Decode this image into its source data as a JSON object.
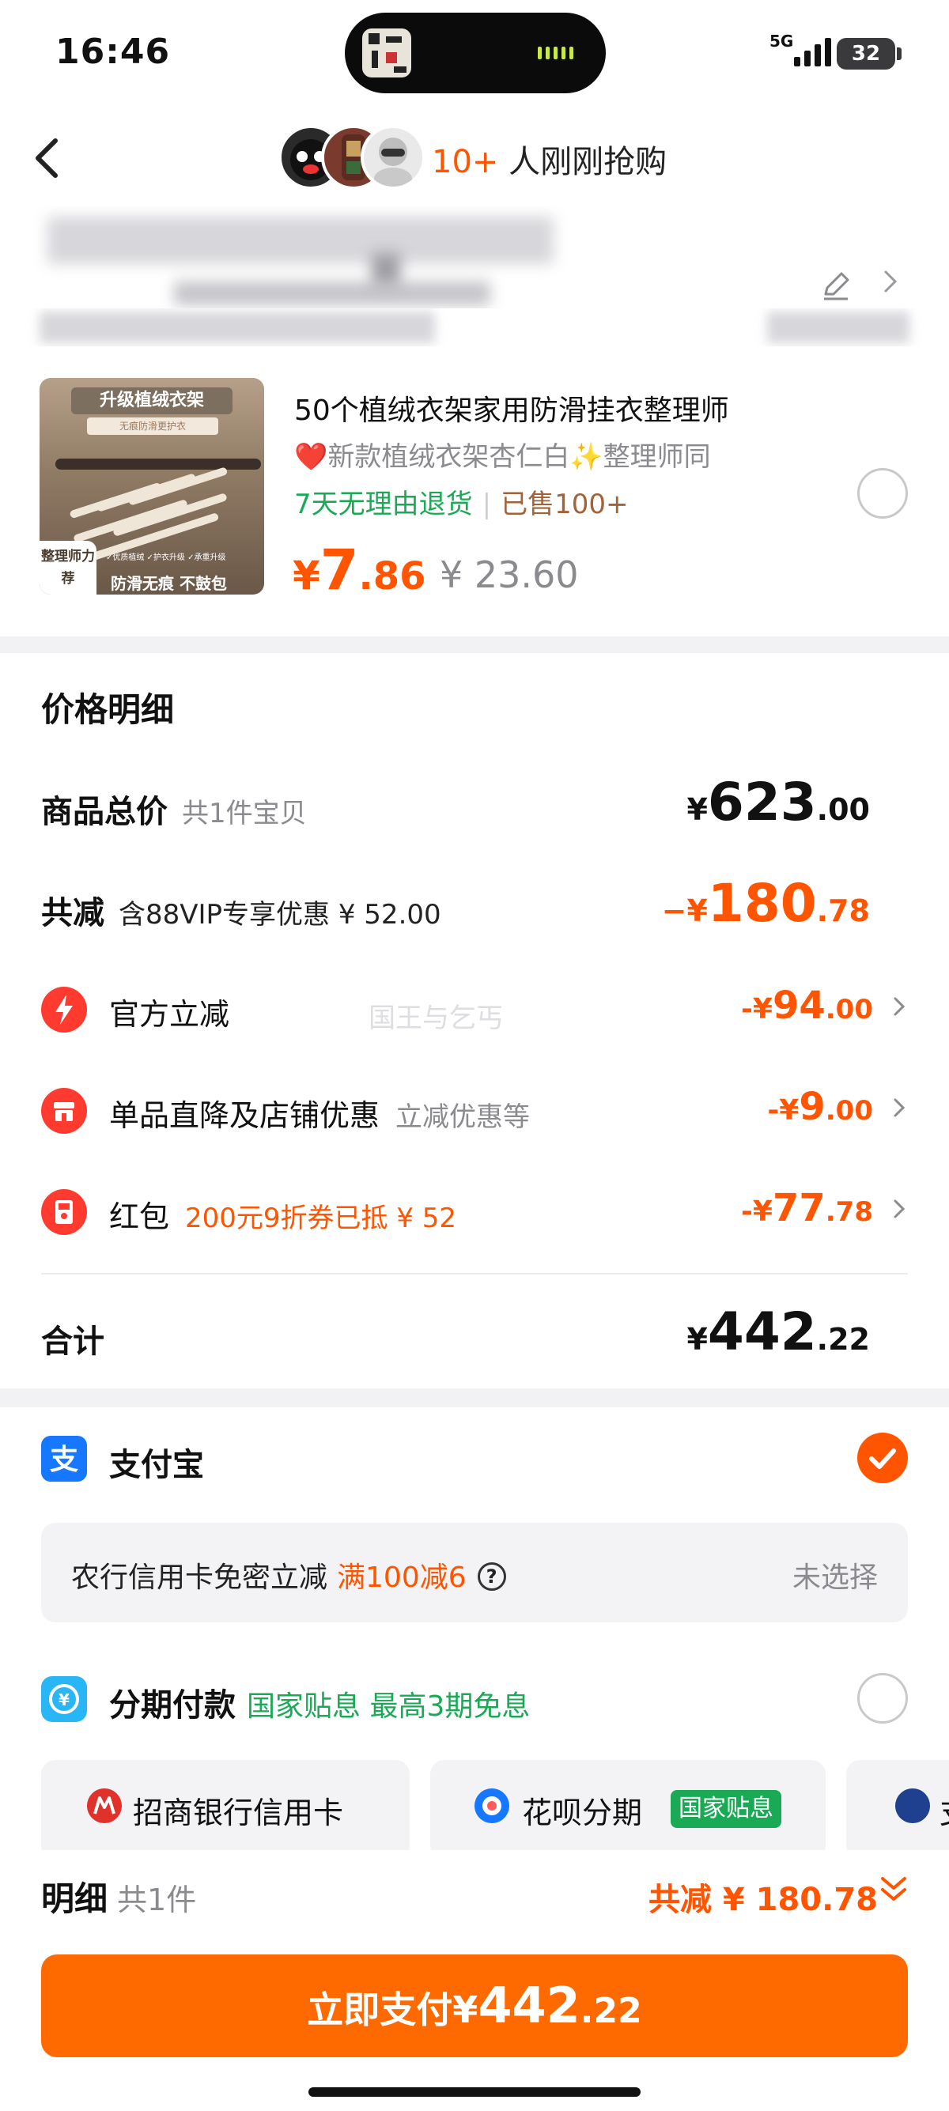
{
  "status_bar": {
    "time": "16:46",
    "network": "5G",
    "battery": "32"
  },
  "header": {
    "buyers_count": "10+",
    "buyers_text": " 人刚刚抢购"
  },
  "product": {
    "title": "50个植绒衣架家用防滑挂衣整理师",
    "sku": "❤️新款植绒衣架杏仁白✨整理师同",
    "return_policy": "7天无理由退货",
    "sold": "已售100+",
    "price_symbol": "¥",
    "price_int": "7",
    "price_dec": ".86",
    "original_price": "¥ 23.60",
    "thumb_banner": "升级植绒衣架",
    "thumb_sub": "无痕防滑更护衣",
    "thumb_badge": "整理师力荐",
    "thumb_features": "✓优质植绒 ✓护衣升级 ✓承重升级",
    "thumb_slogan": "防滑无痕 不鼓包"
  },
  "price_detail": {
    "title": "价格明细",
    "total": {
      "label": "商品总价",
      "note": "共1件宝贝",
      "symbol": "¥",
      "int": "623",
      "dec": ".00"
    },
    "reduce": {
      "label": "共减",
      "note": "含88VIP专享优惠 ¥ 52.00",
      "symbol": "−¥",
      "int": "180",
      "dec": ".78"
    },
    "items": [
      {
        "label": "官方立减",
        "note": "",
        "symbol": "-¥",
        "int": "94",
        "dec": ".00"
      },
      {
        "label": "单品直降及店铺优惠",
        "note": "立减优惠等",
        "symbol": "-¥",
        "int": "9",
        "dec": ".00"
      },
      {
        "label": "红包",
        "note": "200元9折券已抵 ¥ 52",
        "symbol": "-¥",
        "int": "77",
        "dec": ".78"
      }
    ],
    "sum": {
      "label": "合计",
      "symbol": "¥",
      "int": "442",
      "dec": ".22"
    },
    "watermark": "国王与乞丐"
  },
  "payment": {
    "alipay": "支付宝",
    "card_offer": "农行信用卡免密立减",
    "card_promo": "满100减6",
    "card_help": "?",
    "card_status": "未选择",
    "installment": "分期付款",
    "installment_note": "国家贴息 最高3期免息",
    "banks": [
      {
        "label": "招商银行信用卡"
      },
      {
        "label": "花呗分期",
        "badge": "国家贴息"
      },
      {
        "label": "支"
      }
    ]
  },
  "bottom": {
    "summary_label": "明细",
    "summary_count": "共1件",
    "summary_reduce": "共减 ¥ 180.78",
    "pay_text": "立即支付",
    "pay_symbol": "¥",
    "pay_int": "442",
    "pay_dec": ".22"
  },
  "colors": {
    "accent": "#ff5500",
    "pay_button": "#ff6a00",
    "green": "#1aaa55",
    "alipay": "#1677ff"
  }
}
